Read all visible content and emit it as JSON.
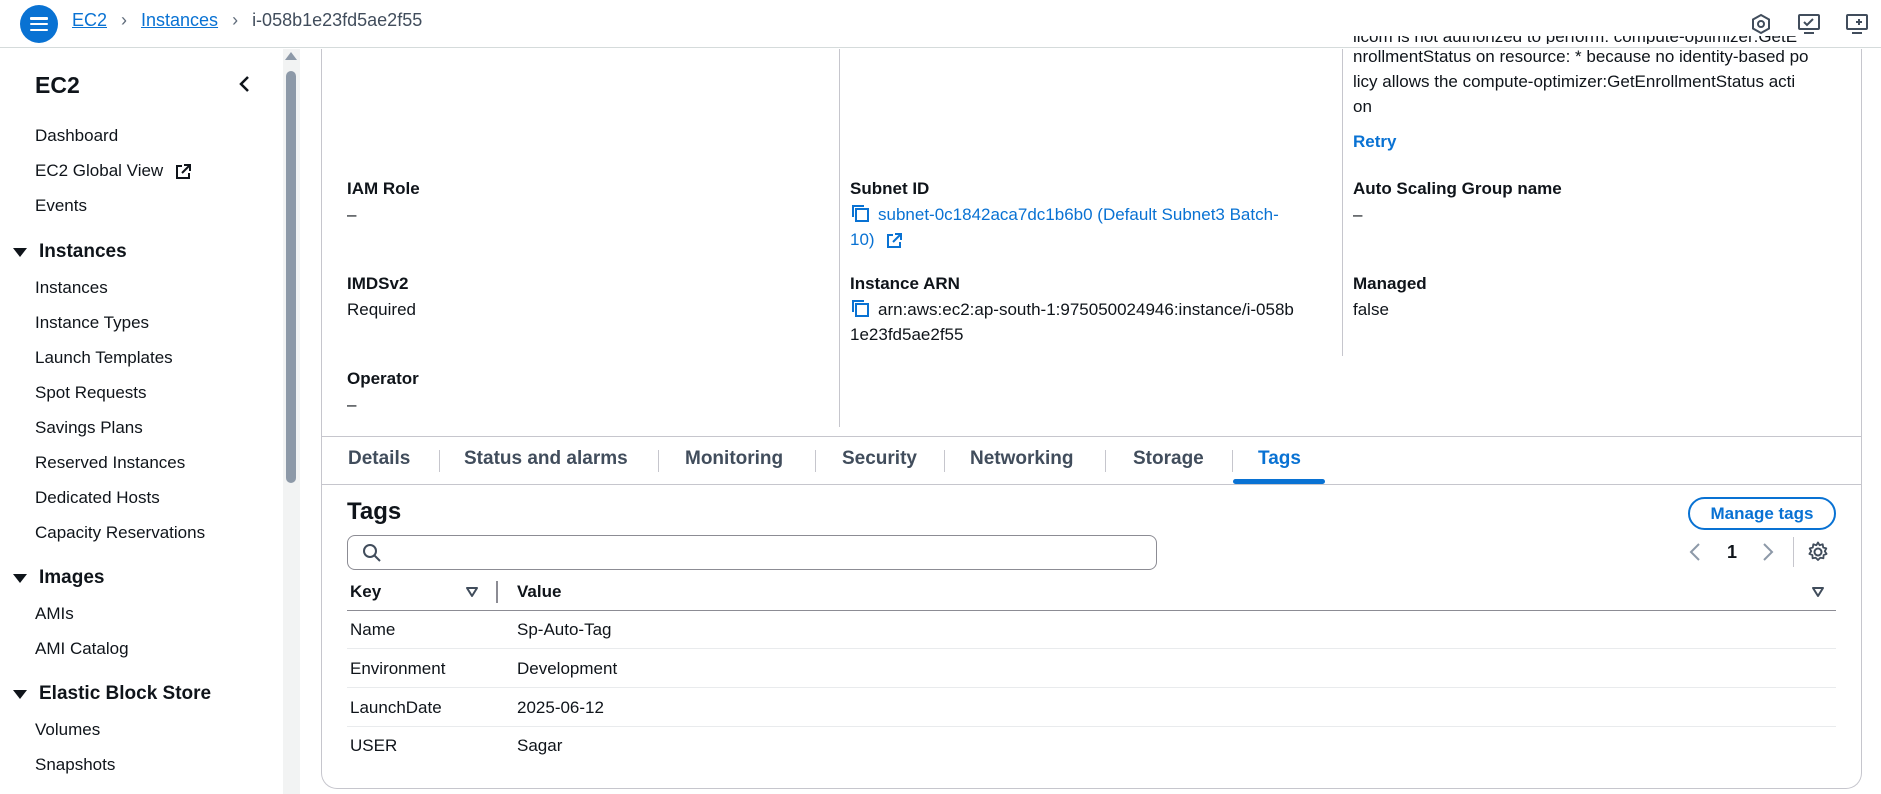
{
  "breadcrumb": {
    "items": [
      "EC2",
      "Instances"
    ],
    "current": "i-058b1e23fd5ae2f55"
  },
  "sidebar": {
    "title": "EC2",
    "top_items": [
      "Dashboard",
      "EC2 Global View",
      "Events"
    ],
    "sections": [
      {
        "label": "Instances",
        "items": [
          "Instances",
          "Instance Types",
          "Launch Templates",
          "Spot Requests",
          "Savings Plans",
          "Reserved Instances",
          "Dedicated Hosts",
          "Capacity Reservations"
        ]
      },
      {
        "label": "Images",
        "items": [
          "AMIs",
          "AMI Catalog"
        ]
      },
      {
        "label": "Elastic Block Store",
        "items": [
          "Volumes",
          "Snapshots"
        ]
      }
    ]
  },
  "details": {
    "error_text": "licom is not authorized to perform: compute-optimizer:GetEnrollmentStatus on resource: * because no identity-based policy allows the compute-optimizer:GetEnrollmentStatus action",
    "error_line1": "licom is not authorized to perform: compute-optimizer:GetE",
    "error_line2": "nrollmentStatus on resource: * because no identity-based po",
    "error_line3": "licy allows the compute-optimizer:GetEnrollmentStatus acti",
    "error_line4": "on",
    "retry_label": "Retry",
    "iam_role": {
      "label": "IAM Role",
      "value": "–"
    },
    "subnet_id": {
      "label": "Subnet ID",
      "value_line1": "subnet-0c1842aca7dc1b6b0 (Default Subnet3 Batch-",
      "value_line2": "10)"
    },
    "asg_name": {
      "label": "Auto Scaling Group name",
      "value": "–"
    },
    "imdsv2": {
      "label": "IMDSv2",
      "value": "Required"
    },
    "instance_arn": {
      "label": "Instance ARN",
      "value_line1": "arn:aws:ec2:ap-south-1:975050024946:instance/i-058b",
      "value_line2": "1e23fd5ae2f55"
    },
    "managed": {
      "label": "Managed",
      "value": "false"
    },
    "operator": {
      "label": "Operator",
      "value": "–"
    }
  },
  "tabs": [
    "Details",
    "Status and alarms",
    "Monitoring",
    "Security",
    "Networking",
    "Storage",
    "Tags"
  ],
  "active_tab": "Tags",
  "tags": {
    "title": "Tags",
    "manage_label": "Manage tags",
    "search_placeholder": "",
    "page": "1",
    "columns": [
      "Key",
      "Value"
    ],
    "rows": [
      {
        "key": "Name",
        "value": "Sp-Auto-Tag"
      },
      {
        "key": "Environment",
        "value": "Development"
      },
      {
        "key": "LaunchDate",
        "value": "2025-06-12"
      },
      {
        "key": "USER",
        "value": "Sagar"
      }
    ]
  },
  "colors": {
    "accent": "#0972d3",
    "text": "#0f141a",
    "border": "#c6c6cd"
  }
}
